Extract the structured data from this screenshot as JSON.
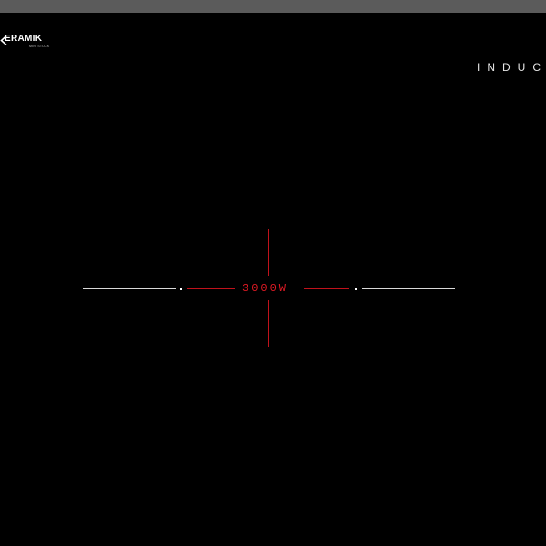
{
  "brand": {
    "name": "ERAMIK",
    "tagline": "MINI STOCK",
    "logo_icon": "k-chevron-icon"
  },
  "hob": {
    "title": "INDUC",
    "power_label": "3000W"
  },
  "colors": {
    "background": "#000000",
    "topbar": "#5b5b5b",
    "accent": "#c0121b",
    "text": "#e6e6e6"
  }
}
